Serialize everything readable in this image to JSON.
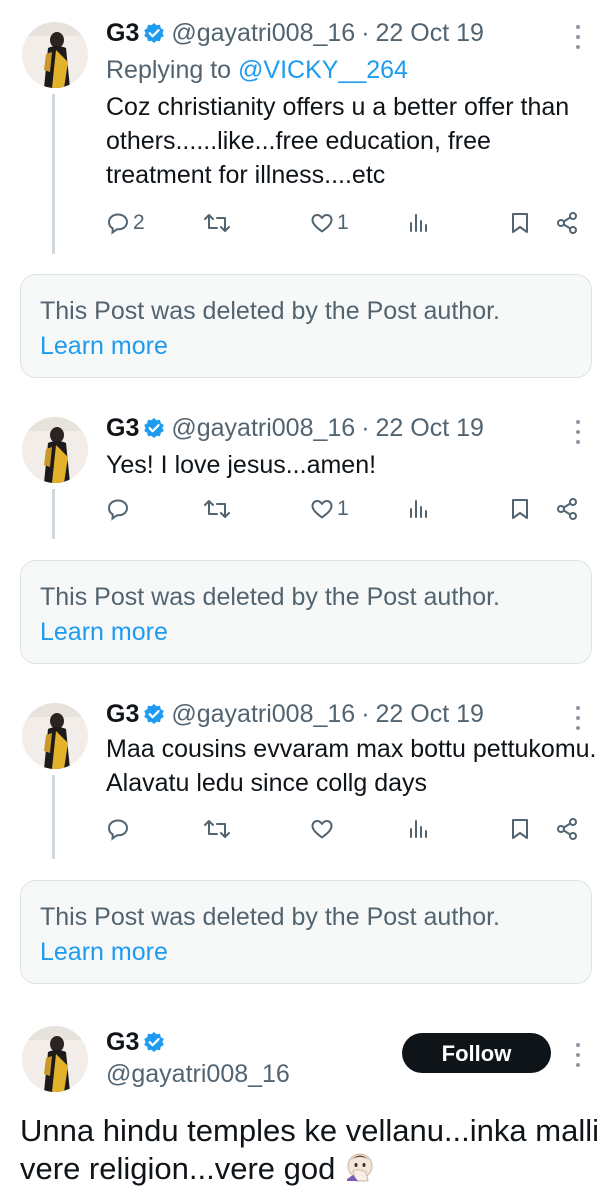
{
  "colors": {
    "text": "#0f1419",
    "secondary": "#536471",
    "link": "#1d9bf0",
    "verified": "#1d9bf0",
    "thread_line": "#cfd9de",
    "deleted_bg": "#f7f9f9",
    "follow_bg": "#0f1419"
  },
  "icons": [
    "verified-badge-icon",
    "more-icon",
    "reply-icon",
    "retweet-icon",
    "like-icon",
    "views-icon",
    "bookmark-icon",
    "share-icon"
  ],
  "tweets": [
    {
      "name": "G3",
      "handle": "@gayatri008_16",
      "dot": "·",
      "date": "22 Oct 19",
      "replying_prefix": "Replying to",
      "replying_handle": "@VICKY__264",
      "text": "Coz christianity offers u a better offer than others......like...free education, free treatment for illness....etc",
      "replies": "2",
      "likes": "1"
    },
    {
      "name": "G3",
      "handle": "@gayatri008_16",
      "dot": "·",
      "date": "22 Oct 19",
      "text": "Yes! I love jesus...amen!",
      "likes": "1"
    },
    {
      "name": "G3",
      "handle": "@gayatri008_16",
      "dot": "·",
      "date": "22 Oct 19",
      "text": "Maa cousins evvaram max bottu pettukomu. Alavatu ledu since collg days"
    }
  ],
  "deleted_notice": {
    "message": "This Post was deleted by the Post author.",
    "learn_more": "Learn more"
  },
  "main_post": {
    "name": "G3",
    "handle": "@gayatri008_16",
    "follow_label": "Follow",
    "text": "Unna hindu temples ke vellanu...inka malli vere religion...vere god"
  }
}
